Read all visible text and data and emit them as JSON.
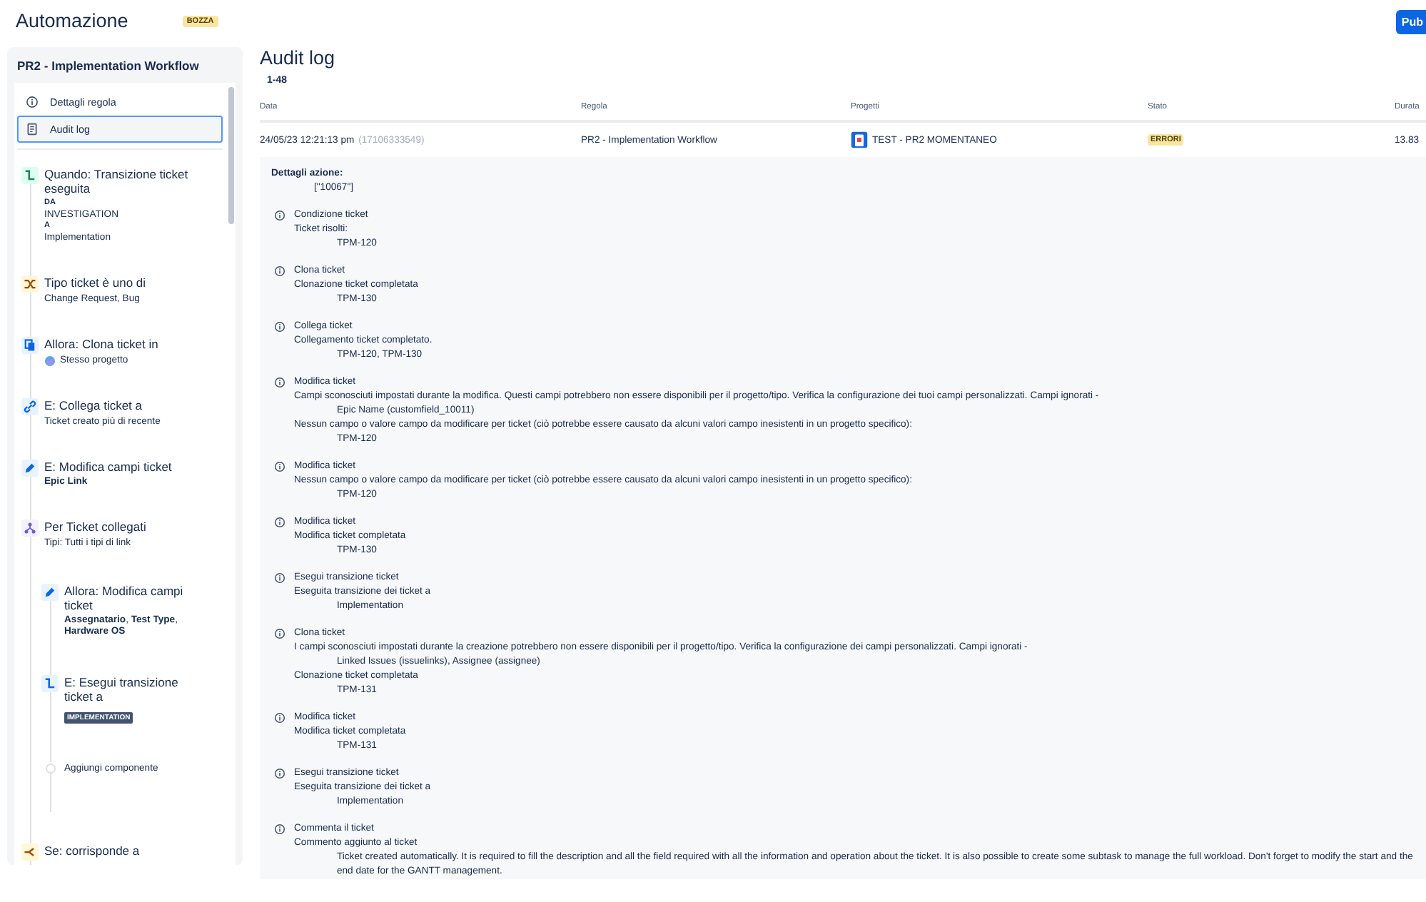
{
  "header": {
    "title": "Automazione",
    "badge": "BOZZA",
    "publish_button": "Pub"
  },
  "sidebar": {
    "title": "PR2 - Implementation Workflow",
    "nav": [
      {
        "label": "Dettagli regola",
        "kind": "info",
        "selected": false
      },
      {
        "label": "Audit log",
        "kind": "doc",
        "selected": true
      }
    ],
    "steps": [
      {
        "kind": "trigger",
        "title": "Quando: Transizione ticket eseguita",
        "details": [
          {
            "kind": "label",
            "text": "DA"
          },
          {
            "kind": "text",
            "text": "INVESTIGATION"
          },
          {
            "kind": "label",
            "text": "A"
          },
          {
            "kind": "text",
            "text": "Implementation"
          }
        ]
      },
      {
        "kind": "condition",
        "title": "Tipo ticket è uno di",
        "details": [
          {
            "kind": "text",
            "text": "Change Request, Bug"
          }
        ]
      },
      {
        "kind": "clone",
        "title": "Allora: Clona ticket in",
        "details": [
          {
            "kind": "globe",
            "text": "Stesso progetto"
          }
        ]
      },
      {
        "kind": "link",
        "title": "E: Collega ticket a",
        "details": [
          {
            "kind": "text",
            "text": "Ticket creato più di recente"
          }
        ]
      },
      {
        "kind": "edit",
        "title": "E: Modifica campi ticket",
        "details": [
          {
            "kind": "rich",
            "text": "**Epic Link**"
          }
        ]
      },
      {
        "kind": "branch",
        "title": "Per Ticket collegati",
        "details": [
          {
            "kind": "text",
            "text": "Tipi: Tutti i tipi di link"
          }
        ],
        "children": [
          {
            "kind": "edit",
            "title": "Allora: Modifica campi ticket",
            "details": [
              {
                "kind": "rich",
                "text": "**Assegnatario**, **Test Type**, **Hardware OS**"
              }
            ]
          },
          {
            "kind": "transition",
            "title": "E: Esegui transizione ticket a",
            "details": [
              {
                "kind": "lozenge",
                "text": "IMPLEMENTATION"
              }
            ]
          },
          {
            "kind": "add",
            "title": "Aggiungi componente"
          }
        ]
      },
      {
        "kind": "ifmatch",
        "title": "Se: corrisponde a"
      }
    ]
  },
  "main": {
    "title": "Audit log",
    "range": "1-48",
    "table": {
      "columns": [
        "Data",
        "Regola",
        "Progetti",
        "Stato",
        "Durata"
      ],
      "rows": [
        {
          "date": "24/05/23 12:21:13 pm",
          "id": "(17106333549)",
          "rule": "PR2 - Implementation Workflow",
          "project": "TEST - PR2 MOMENTANEO",
          "status": "ERRORI",
          "duration": "13.83",
          "expanded": true
        }
      ]
    },
    "details": {
      "title": "Dettagli azione:",
      "value": "[\"10067\"]",
      "entries": [
        {
          "title": "Condizione ticket",
          "lines": [
            {
              "kind": "text",
              "text": "Ticket risolti:"
            },
            {
              "kind": "indent",
              "text": "TPM-120"
            }
          ]
        },
        {
          "title": "Clona ticket",
          "lines": [
            {
              "kind": "text",
              "text": "Clonazione ticket completata"
            },
            {
              "kind": "indent",
              "text": "TPM-130"
            }
          ]
        },
        {
          "title": "Collega ticket",
          "lines": [
            {
              "kind": "text",
              "text": "Collegamento ticket completato."
            },
            {
              "kind": "indent",
              "text": "TPM-120, TPM-130"
            }
          ]
        },
        {
          "title": "Modifica ticket",
          "lines": [
            {
              "kind": "text",
              "text": "Campi sconosciuti impostati durante la modifica. Questi campi potrebbero non essere disponibili per il progetto/tipo. Verifica la configurazione dei tuoi campi personalizzati. Campi ignorati -"
            },
            {
              "kind": "indent",
              "text": "Epic Name (customfield_10011)"
            },
            {
              "kind": "text",
              "text": "Nessun campo o valore campo da modificare per ticket (ciò potrebbe essere causato da alcuni valori campo inesistenti in un progetto specifico):"
            },
            {
              "kind": "indent",
              "text": "TPM-120"
            }
          ]
        },
        {
          "title": "Modifica ticket",
          "lines": [
            {
              "kind": "text",
              "text": "Nessun campo o valore campo da modificare per ticket (ciò potrebbe essere causato da alcuni valori campo inesistenti in un progetto specifico):"
            },
            {
              "kind": "indent",
              "text": "TPM-120"
            }
          ]
        },
        {
          "title": "Modifica ticket",
          "lines": [
            {
              "kind": "text",
              "text": "Modifica ticket completata"
            },
            {
              "kind": "indent",
              "text": "TPM-130"
            }
          ]
        },
        {
          "title": "Esegui transizione ticket",
          "lines": [
            {
              "kind": "text",
              "text": "Eseguita transizione dei ticket a"
            },
            {
              "kind": "indent",
              "text": "Implementation"
            }
          ]
        },
        {
          "title": "Clona ticket",
          "lines": [
            {
              "kind": "text",
              "text": "I campi sconosciuti impostati durante la creazione potrebbero non essere disponibili per il progetto/tipo. Verifica la configurazione dei campi personalizzati. Campi ignorati -"
            },
            {
              "kind": "indent",
              "text": "Linked Issues (issuelinks), Assignee (assignee)"
            },
            {
              "kind": "text",
              "text": "Clonazione ticket completata"
            },
            {
              "kind": "indent",
              "text": "TPM-131"
            }
          ]
        },
        {
          "title": "Modifica ticket",
          "lines": [
            {
              "kind": "text",
              "text": "Modifica ticket completata"
            },
            {
              "kind": "indent",
              "text": "TPM-131"
            }
          ]
        },
        {
          "title": "Esegui transizione ticket",
          "lines": [
            {
              "kind": "text",
              "text": "Eseguita transizione dei ticket a"
            },
            {
              "kind": "indent",
              "text": "Implementation"
            }
          ]
        },
        {
          "title": "Commenta il ticket",
          "lines": [
            {
              "kind": "text",
              "text": "Commento aggiunto al ticket"
            },
            {
              "kind": "indent",
              "text": "Ticket created automatically. It is required to fill the description and all the field required with all the information and operation about the ticket. It is also possible to create some subtask to manage the full workload. Don't forget to modify the start and the end date for the GANTT management."
            }
          ]
        }
      ]
    }
  }
}
